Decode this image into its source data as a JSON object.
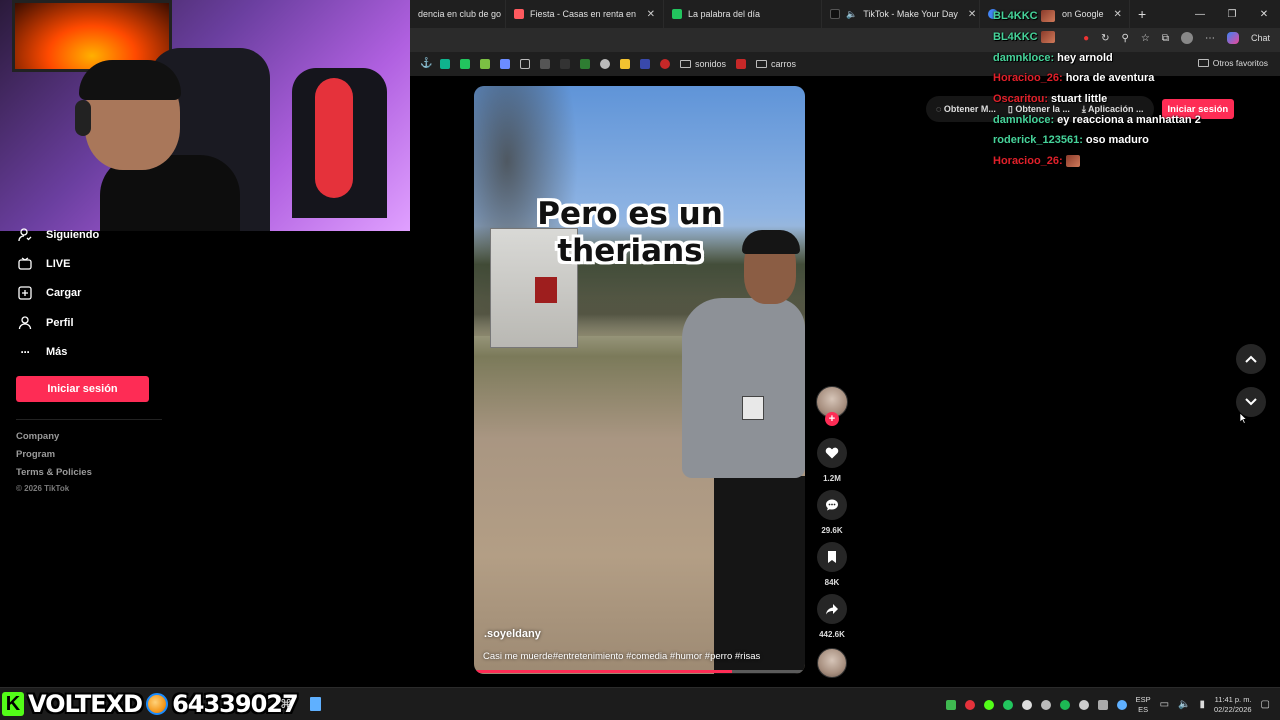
{
  "browser": {
    "tabs": [
      {
        "label": "dencia en club de go",
        "color": "#3b82f6"
      },
      {
        "label": "Fiesta - Casas en renta en Panamá",
        "color": "#ff5a5f"
      },
      {
        "label": "La palabra del día",
        "color": "#22c55e"
      },
      {
        "label": "TikTok - Make Your Day",
        "color": "#000000"
      },
      {
        "label": "on Google",
        "color": "#4285f4"
      }
    ],
    "bookmarks": {
      "folder1": "sonidos",
      "folder2": "carros",
      "other_favorites": "Otros favoritos"
    },
    "chat_button": "Chat"
  },
  "sidebar": {
    "items": [
      {
        "label": "Siguiendo",
        "icon": "following-icon"
      },
      {
        "label": "LIVE",
        "icon": "live-icon"
      },
      {
        "label": "Cargar",
        "icon": "upload-icon"
      },
      {
        "label": "Perfil",
        "icon": "profile-icon"
      },
      {
        "label": "Más",
        "icon": "more-icon"
      }
    ],
    "login_button": "Iniciar sesión",
    "footer_links": [
      "Company",
      "Program",
      "Terms & Policies"
    ],
    "copyright": "© 2026 TikTok"
  },
  "top_actions": {
    "items": [
      "Obtener M...",
      "Obtener la ...",
      "Aplicación ..."
    ],
    "login_button": "Iniciar sesión"
  },
  "video": {
    "caption_line1": "Pero es un",
    "caption_line2": "therians",
    "username": ".soyeldany",
    "description": "Casi me muerde#entretenimiento #comedia #humor #perro #risas",
    "progress": 0.78
  },
  "actions": {
    "likes": "1.2M",
    "comments": "29.6K",
    "saves": "84K",
    "shares": "442.6K"
  },
  "chat": {
    "messages": [
      {
        "user": "BL4KKC",
        "text": "",
        "color": "#46d39a",
        "emote": true
      },
      {
        "user": "damnkloce:",
        "text": "hey arnold",
        "color": "#46d39a"
      },
      {
        "user": "Horacioo_26:",
        "text": "hora de aventura",
        "color": "#e0202a"
      },
      {
        "user": "Oscaritou:",
        "text": "stuart little",
        "color": "#e0202a"
      },
      {
        "user": "damnkloce:",
        "text": "ey reacciona a manhattan 2",
        "color": "#46d39a"
      },
      {
        "user": "roderick_123561:",
        "text": "oso maduro",
        "color": "#46d39a"
      },
      {
        "user": "Horacioo_26:",
        "text": "",
        "color": "#e0202a",
        "emote": true
      }
    ]
  },
  "stream_overlay": {
    "name": "VOLTEXD",
    "number": "64339027"
  },
  "taskbar": {
    "lang_top": "ESP",
    "lang_bottom": "ES",
    "time": "11:41 p. m.",
    "date": "02/22/2026"
  }
}
